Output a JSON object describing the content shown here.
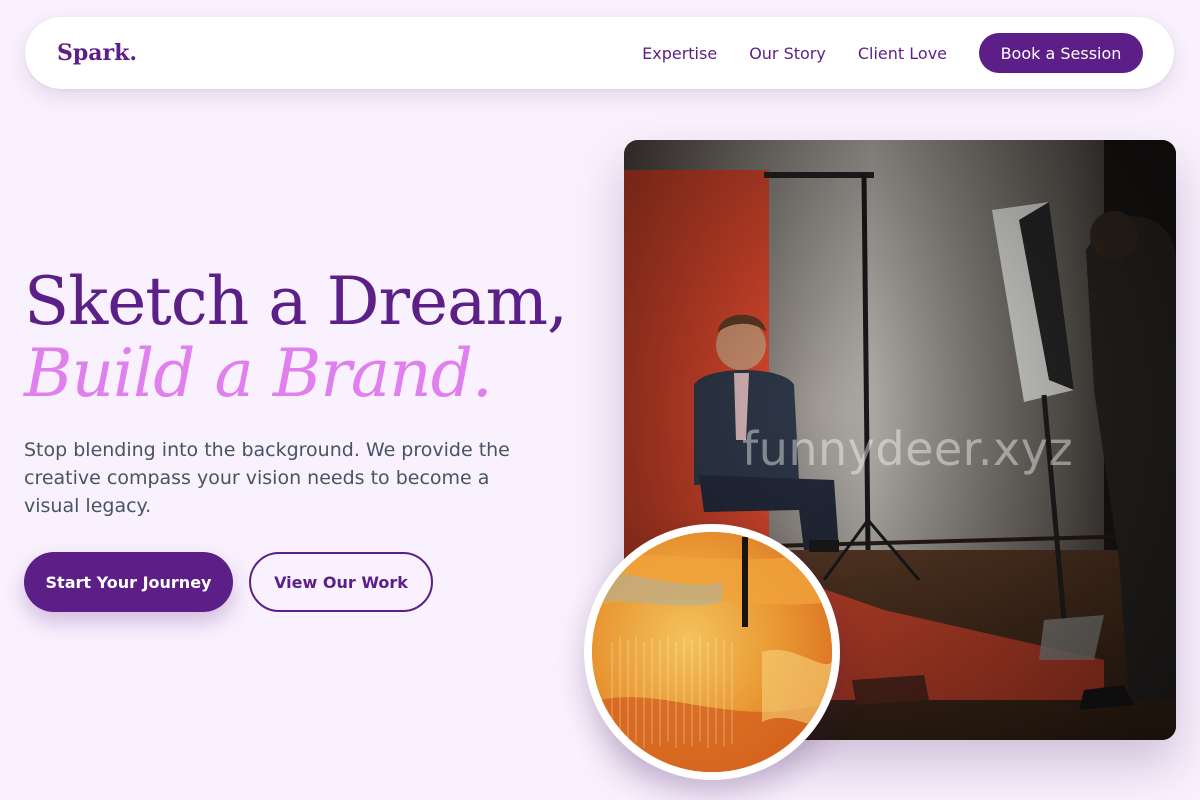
{
  "nav": {
    "logo": "Spark.",
    "links": [
      "Expertise",
      "Our Story",
      "Client Love"
    ],
    "cta": "Book a Session"
  },
  "hero": {
    "title_line1": "Sketch a Dream,",
    "title_line2": "Build a Brand.",
    "subtitle": "Stop blending into the background. We provide the creative compass your vision needs to become a visual legacy.",
    "primary_button": "Start Your Journey",
    "secondary_button": "View Our Work"
  },
  "media": {
    "main_image": "photo-studio-portrait-session",
    "watermark": "funnydeer.xyz",
    "circle_image": "orange-textured-painting"
  },
  "colors": {
    "brand": "#5b1f87",
    "accent": "#e07fee",
    "background": "#f9f1fd",
    "body_text": "#475466"
  }
}
